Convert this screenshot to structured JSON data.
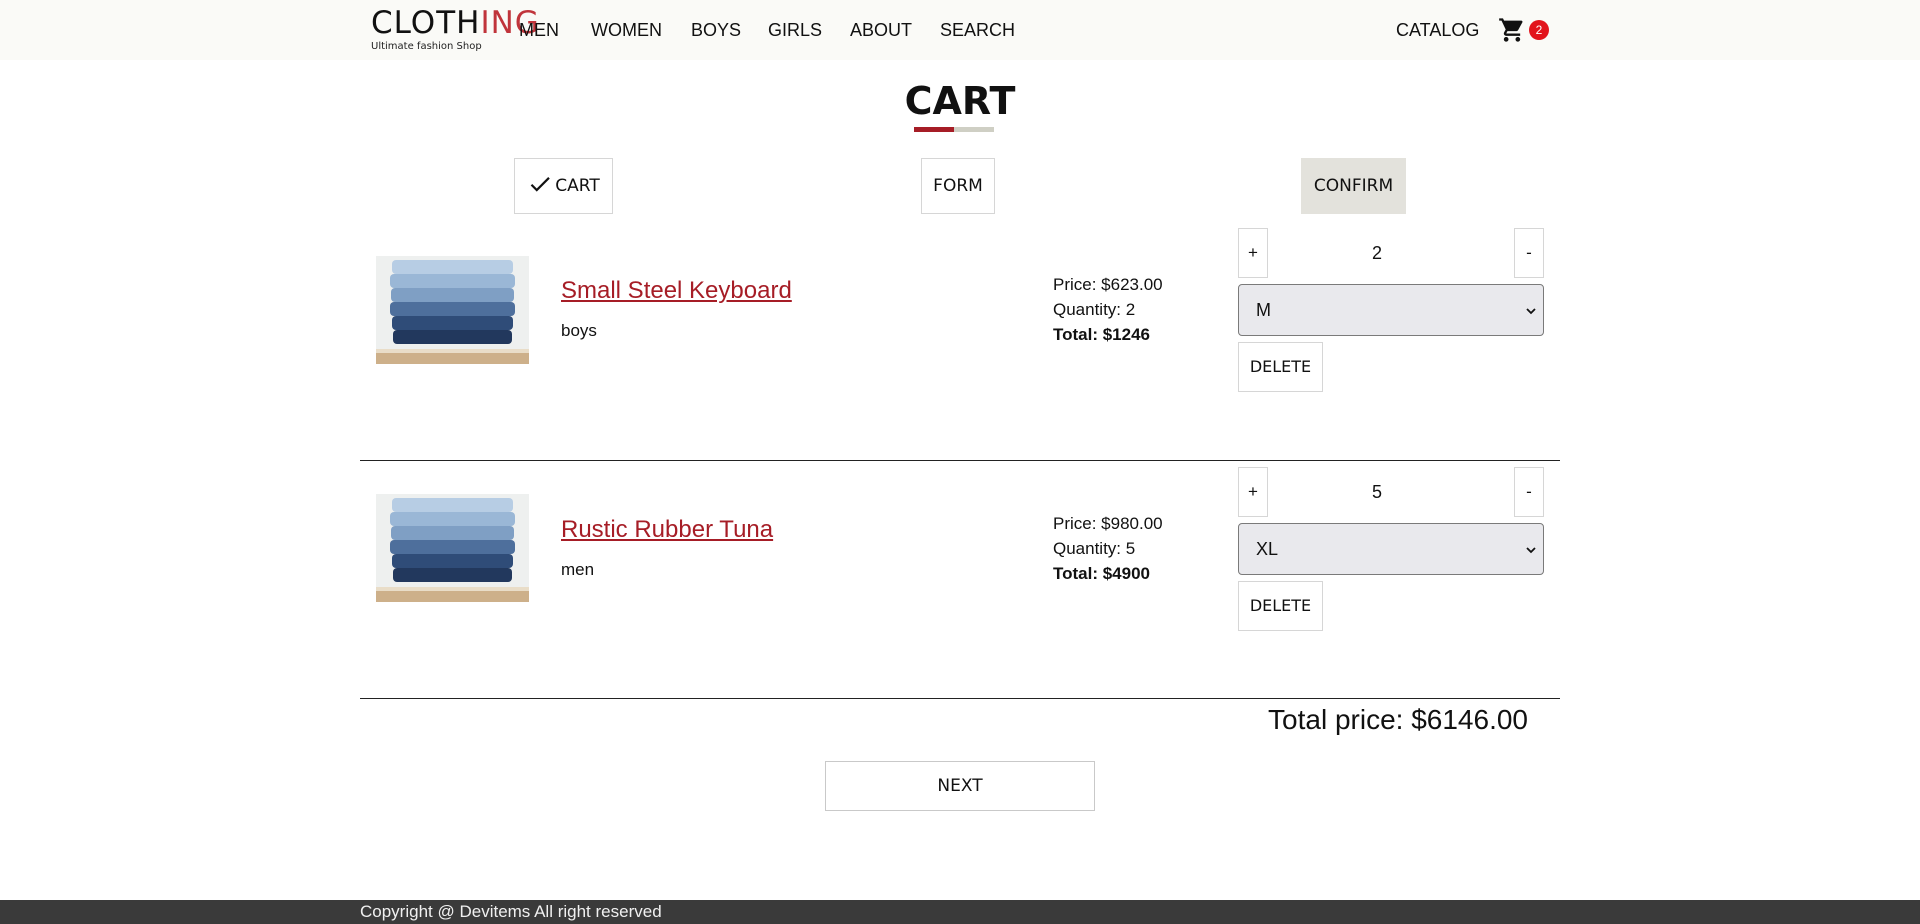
{
  "brand": {
    "logo_dark": "CLOTH",
    "logo_red": "ING",
    "tagline": "Ultimate fashion Shop"
  },
  "nav": {
    "links": [
      "MEN",
      "WOMEN",
      "BOYS",
      "GIRLS",
      "ABOUT",
      "SEARCH"
    ],
    "catalog": "CATALOG",
    "cart_count": "2"
  },
  "page": {
    "title": "CART"
  },
  "steps": {
    "cart": "CART",
    "form": "FORM",
    "confirm": "CONFIRM"
  },
  "items": [
    {
      "name": "Small Steel Keyboard",
      "category": "boys",
      "price": "Price: $623.00",
      "quantity": "Quantity: 2",
      "total": "Total: $1246",
      "qty_value": "2",
      "size": "M",
      "plus": "+",
      "minus": "-",
      "delete": "DELETE"
    },
    {
      "name": "Rustic Rubber Tuna",
      "category": "men",
      "price": "Price: $980.00",
      "quantity": "Quantity: 5",
      "total": "Total: $4900",
      "qty_value": "5",
      "size": "XL",
      "plus": "+",
      "minus": "-",
      "delete": "DELETE"
    }
  ],
  "summary": {
    "total_price": "Total price: $6146.00",
    "next": "NEXT"
  },
  "footer": {
    "text": "Copyright @ Devitems All right reserved"
  },
  "colors": {
    "accent_red": "#a61d26",
    "badge_red": "#e2141c",
    "header_bg": "#fafaf7",
    "footer_bg": "#3a3a3a",
    "active_step_bg": "#e3e2dc"
  },
  "icons": {
    "cart": "shopping-cart-icon",
    "check": "check-icon",
    "select": "chevron-down-icon",
    "product": "folded-jeans-image"
  }
}
